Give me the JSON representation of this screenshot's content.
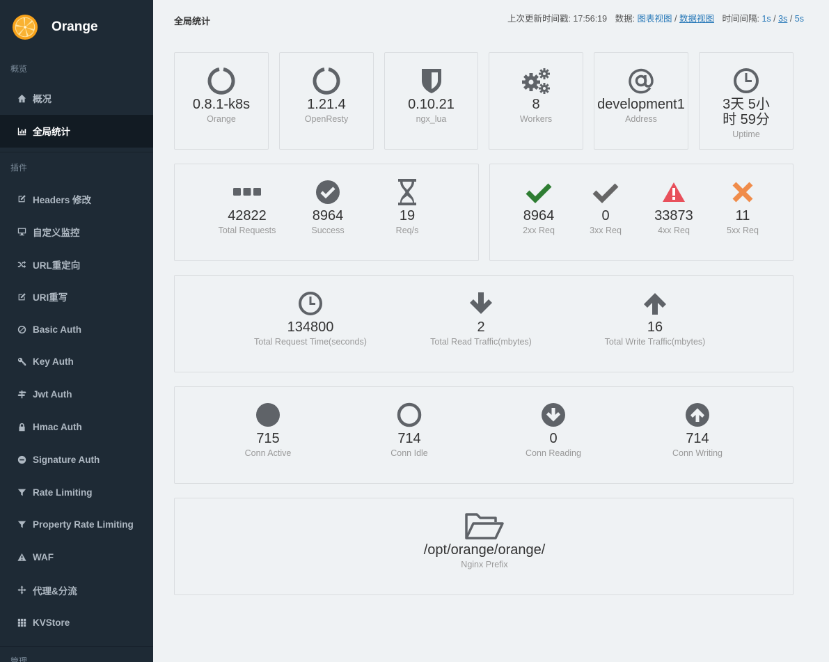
{
  "app": {
    "name": "Orange"
  },
  "sidebar": {
    "section_overview": "概览",
    "section_plugins": "插件",
    "section_manage": "管理",
    "items": [
      {
        "label": "概况",
        "icon": "home-icon"
      },
      {
        "label": "全局统计",
        "icon": "bar-chart-icon",
        "active": true
      },
      {
        "label": "Headers 修改",
        "icon": "edit-icon"
      },
      {
        "label": "自定义监控",
        "icon": "monitor-icon"
      },
      {
        "label": "URL重定向",
        "icon": "shuffle-icon"
      },
      {
        "label": "URI重写",
        "icon": "edit-icon"
      },
      {
        "label": "Basic Auth",
        "icon": "ban-icon"
      },
      {
        "label": "Key Auth",
        "icon": "key-icon"
      },
      {
        "label": "Jwt Auth",
        "icon": "signpost-icon"
      },
      {
        "label": "Hmac Auth",
        "icon": "lock-icon"
      },
      {
        "label": "Signature Auth",
        "icon": "minus-circle-icon"
      },
      {
        "label": "Rate Limiting",
        "icon": "filter-icon"
      },
      {
        "label": "Property Rate Limiting",
        "icon": "filter-icon"
      },
      {
        "label": "WAF",
        "icon": "warning-icon"
      },
      {
        "label": "代理&分流",
        "icon": "move-icon"
      },
      {
        "label": "KVStore",
        "icon": "grid-icon"
      }
    ]
  },
  "header": {
    "title": "全局统计",
    "last_update_label": "上次更新时间戳:",
    "last_update_time": "17:56:19",
    "data_label": "数据:",
    "chart_view": "图表视图",
    "sep": "/",
    "data_view": "数据视图",
    "interval_label": "时间间隔:",
    "interval_1s": "1s",
    "interval_3s": "3s",
    "interval_5s": "5s"
  },
  "info": {
    "orange": {
      "value": "0.8.1-k8s",
      "label": "Orange",
      "icon": "circle-notch-icon"
    },
    "openresty": {
      "value": "1.21.4",
      "label": "OpenResty",
      "icon": "circle-notch-icon"
    },
    "ngx_lua": {
      "value": "0.10.21",
      "label": "ngx_lua",
      "icon": "shield-icon"
    },
    "workers": {
      "value": "8",
      "label": "Workers",
      "icon": "gears-icon"
    },
    "address": {
      "value": "development1",
      "label": "Address",
      "icon": "at-icon"
    },
    "uptime": {
      "value_line1": "3天 5小",
      "value_line2": "时 59分",
      "label": "Uptime",
      "icon": "clock-icon"
    }
  },
  "requests": {
    "total": {
      "value": "42822",
      "label": "Total Requests",
      "icon": "ellipsis-icon"
    },
    "success": {
      "value": "8964",
      "label": "Success",
      "icon": "check-circle-icon"
    },
    "rps": {
      "value": "19",
      "label": "Req/s",
      "icon": "hourglass-icon"
    }
  },
  "status": {
    "s2xx": {
      "value": "8964",
      "label": "2xx Req",
      "icon": "check-icon",
      "color": "#2e7d32"
    },
    "s3xx": {
      "value": "0",
      "label": "3xx Req",
      "icon": "check-icon",
      "color": "#666666"
    },
    "s4xx": {
      "value": "33873",
      "label": "4xx Req",
      "icon": "warning-icon",
      "color": "#e8505b"
    },
    "s5xx": {
      "value": "11",
      "label": "5xx Req",
      "icon": "times-icon",
      "color": "#f08c4a"
    }
  },
  "traffic": {
    "time": {
      "value": "134800",
      "label": "Total Request Time(seconds)",
      "icon": "clock-icon"
    },
    "read": {
      "value": "2",
      "label": "Total Read Traffic(mbytes)",
      "icon": "arrow-down-icon"
    },
    "write": {
      "value": "16",
      "label": "Total Write Traffic(mbytes)",
      "icon": "arrow-up-icon"
    }
  },
  "connections": {
    "active": {
      "value": "715",
      "label": "Conn Active",
      "icon": "circle-icon"
    },
    "idle": {
      "value": "714",
      "label": "Conn Idle",
      "icon": "circle-outline-icon"
    },
    "reading": {
      "value": "0",
      "label": "Conn Reading",
      "icon": "arrow-circle-down-icon"
    },
    "writing": {
      "value": "714",
      "label": "Conn Writing",
      "icon": "arrow-circle-up-icon"
    }
  },
  "prefix": {
    "value": "/opt/orange/orange/",
    "label": "Nginx Prefix",
    "icon": "folder-open-icon"
  }
}
